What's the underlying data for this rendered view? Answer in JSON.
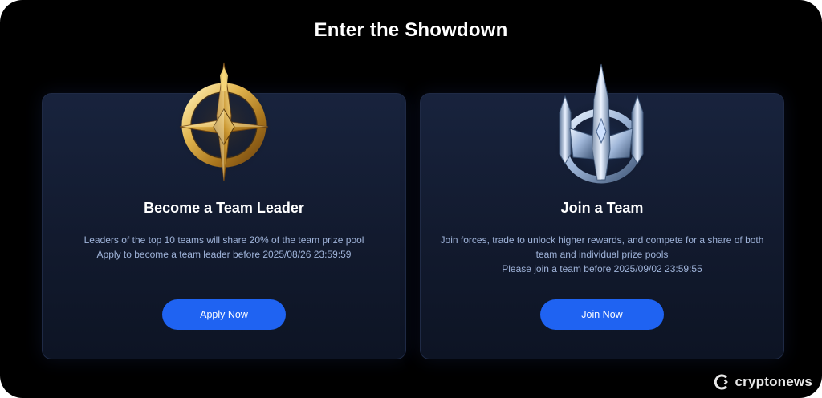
{
  "header": {
    "title": "Enter the Showdown"
  },
  "cards": [
    {
      "emblem": "gold-compass-star-icon",
      "title": "Become a Team Leader",
      "lines": [
        "Leaders of the top 10 teams will share 20% of the team prize pool",
        "Apply to become a team leader before 2025/08/26 23:59:59"
      ],
      "button_label": "Apply Now"
    },
    {
      "emblem": "silver-starship-icon",
      "title": "Join a Team",
      "lines": [
        "Join forces, trade to unlock higher rewards, and compete for a share of both team and individual prize pools",
        "Please join a team before 2025/09/02 23:59:55"
      ],
      "button_label": "Join Now"
    }
  ],
  "watermark": {
    "text": "cryptonews"
  },
  "colors": {
    "background": "#000000",
    "card": "#151f36",
    "accent": "#1f63f2",
    "body_text": "#9fb3d9",
    "gold": "#d9a83a",
    "silver": "#b9cbe6"
  }
}
